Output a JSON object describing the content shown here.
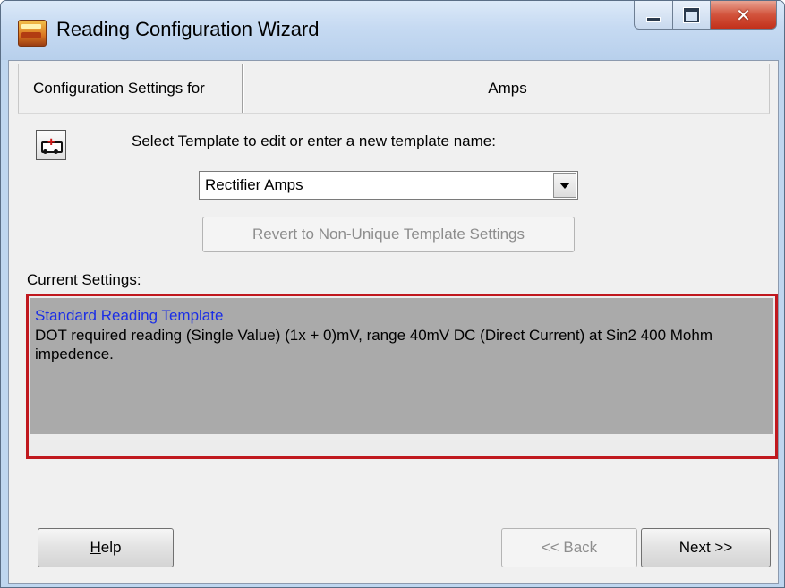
{
  "window": {
    "title": "Reading Configuration Wizard",
    "caption_buttons": [
      "minimize-icon",
      "maximize-icon",
      "close-icon"
    ]
  },
  "header": {
    "label": "Configuration Settings for",
    "value": "Amps"
  },
  "template": {
    "prompt": "Select Template to edit or enter a new template name:",
    "selected": "Rectifier Amps",
    "revert_label": "Revert to Non-Unique Template Settings",
    "tool_icon": "ambulance-icon"
  },
  "current": {
    "label": "Current Settings:",
    "title": "Standard Reading Template",
    "description": "DOT required reading (Single Value) (1x + 0)mV, range 40mV DC (Direct Current) at Sin2 400 Mohm impedence.",
    "title_color": "#1b2ee6",
    "highlight_color": "#c0181e"
  },
  "footer": {
    "help_prefix": "H",
    "help_rest": "elp",
    "back_label": "<< Back",
    "next_label": "Next >>"
  }
}
